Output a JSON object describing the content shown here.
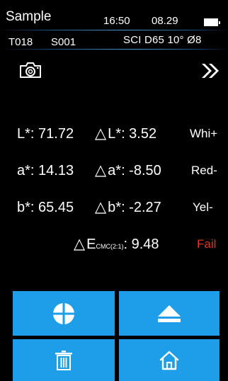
{
  "header": {
    "title": "Sample",
    "time": "16:50",
    "date": "08.29",
    "trial_id": "T018",
    "sample_id": "S001",
    "conditions": "SCI  D65  10°  Ø8"
  },
  "readings": {
    "L": {
      "label": "L*: 71.72",
      "delta": "L*: 3.52",
      "desc": "Whi+"
    },
    "a": {
      "label": "a*: 14.13",
      "delta": "a*: -8.50",
      "desc": "Red-"
    },
    "b": {
      "label": "b*: 65.45",
      "delta": "b*: -2.27",
      "desc": "Yel-"
    },
    "de": {
      "prefix": "E",
      "formula": "CMC(2:1)",
      "value": ": 9.48",
      "result": "Fail"
    }
  },
  "icons": {
    "camera": "camera-icon",
    "next": "double-chevron-right-icon",
    "measure": "crosshair-circle-icon",
    "eject": "eject-icon",
    "delete": "trash-icon",
    "home": "home-icon"
  },
  "colors": {
    "background": "#000000",
    "button": "#1e9ee9",
    "fail": "#e53228",
    "accent_line": "#4a9ed8"
  }
}
